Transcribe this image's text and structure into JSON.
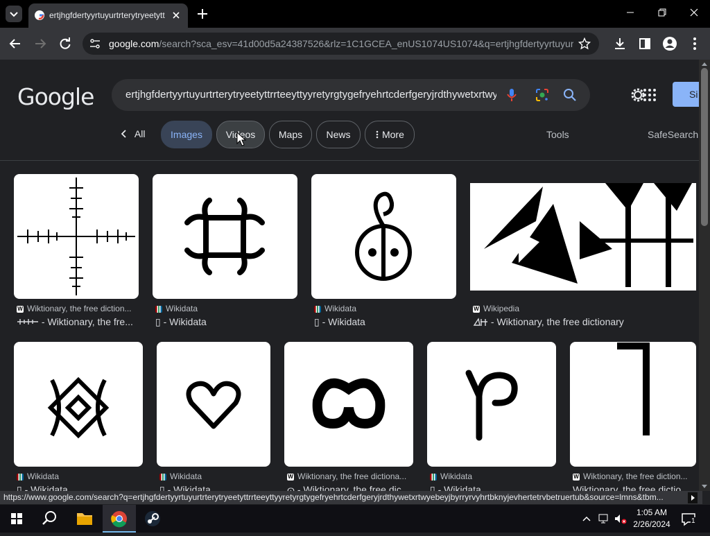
{
  "browser": {
    "tab_title": "ertjhgfdertyyrtuyurtrterytryeetytt",
    "url_host": "google.com",
    "url_path": "/search?sca_esv=41d00d5a24387526&rlz=1C1GCEA_enUS1074US1074&q=ertjhgfdertyyrtuyurt...",
    "status_url": "https://www.google.com/search?q=ertjhgfdertyyrtuyurtrterytryeetyttrrteeyttyyretyrgtygefryehrtcderfgeryjrdthywetxrtwyebeyjbyrryrvyhrtbknyjevhertetrvbetruertub&source=lmns&tbm..."
  },
  "google": {
    "logo": "Google",
    "query": "ertjhgfdertyyrtuyurtrterytryeetyttrrteeyttyyretyrgtygefryehrtcderfgeryjrdthywetxrtwyebeyjbyrryrvyhrtbknyjevhertetrvbetruertub",
    "signin_label": "Si",
    "chips": {
      "all": "All",
      "images": "Images",
      "videos": "Videos",
      "maps": "Maps",
      "news": "News",
      "more": "More",
      "tools": "Tools",
      "safesearch": "SafeSearch"
    }
  },
  "results": [
    {
      "source": "Wiktionary, the free diction...",
      "title": "- Wiktionary, the fre...",
      "favicon": "wiktionary"
    },
    {
      "source": "Wikidata",
      "title": "▯ - Wikidata",
      "favicon": "wikidata"
    },
    {
      "source": "Wikidata",
      "title": "▯ - Wikidata",
      "favicon": "wikidata"
    },
    {
      "source": "Wikipedia",
      "title": "- Wiktionary, the free dictionary",
      "favicon": "wikipedia"
    },
    {
      "source": "Wikidata",
      "title": "▯ - Wikidata",
      "favicon": "wikidata"
    },
    {
      "source": "Wikidata",
      "title": "▯ - Wikidata",
      "favicon": "wikidata"
    },
    {
      "source": "Wiktionary, the free dictiona...",
      "title": "ɷ - Wiktionary, the free dic...",
      "favicon": "wiktionary"
    },
    {
      "source": "Wikidata",
      "title": "▯ - Wikidata",
      "favicon": "wikidata"
    },
    {
      "source": "Wiktionary, the free diction...",
      "title": "Wiktionary, the free dictio...",
      "favicon": "wiktionary"
    }
  ],
  "taskbar": {
    "time": "1:05 AM",
    "date": "2/26/2024",
    "notifications": "1"
  },
  "colors": {
    "page_bg": "#202124",
    "chip_selected_bg": "#394457",
    "chip_selected_text": "#8ab4f8",
    "signin_bg": "#8ab4f8"
  }
}
